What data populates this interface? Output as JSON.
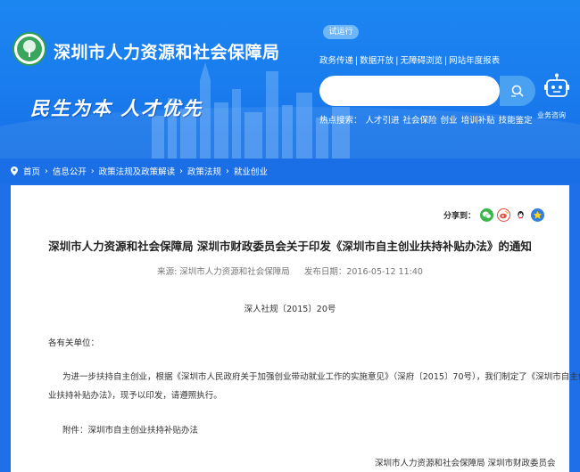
{
  "header": {
    "site_title": "深圳市人力资源和社会保障局",
    "slogan": "民生为本  人才优先",
    "trial_label": "试运行",
    "top_links": [
      "政务传递",
      "数据开放",
      "无障碍浏览",
      "网站年度报表"
    ],
    "search": {
      "placeholder": ""
    },
    "robot_label": "业务咨询",
    "hot_label": "热点搜索：",
    "hot_items": [
      "人才引进",
      "社会保险",
      "创业",
      "培训补贴",
      "技能鉴定"
    ]
  },
  "breadcrumb": [
    "首页",
    "信息公开",
    "政策法规及政策解读",
    "政策法规",
    "就业创业"
  ],
  "share": {
    "label": "分享到：",
    "targets": [
      "wechat-icon",
      "weibo-icon",
      "qq-icon",
      "qzone-icon"
    ]
  },
  "article": {
    "title": "深圳市人力资源和社会保障局 深圳市财政委员会关于印发《深圳市自主创业扶持补贴办法》的通知",
    "source_label": "来源: 深圳市人力资源和社会保障局",
    "date_label": "发布日期：2016-05-12 11:40",
    "doc_no": "深人社规〔2015〕20号",
    "salutation": "各有关单位：",
    "para1_line1": "为进一步扶持自主创业，根据《深圳市人民政府关于加强创业带动就业工作的实施意见》（深府〔2015〕70号），我们制定了《深圳市自主创",
    "para1_line2": "业扶持补贴办法》，现予以印发，请遵照执行。",
    "attachment": "附件：深圳市自主创业扶持补贴办法",
    "signature": "深圳市人力资源和社会保障局 深圳市财政委员会"
  },
  "colors": {
    "brand_blue": "#1a7cee",
    "content_bg": "#ffffff",
    "text": "#333333"
  }
}
